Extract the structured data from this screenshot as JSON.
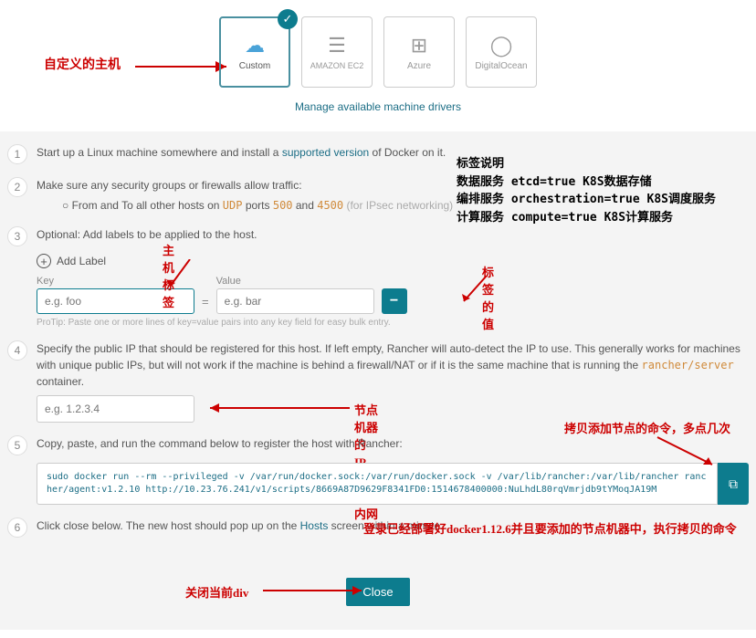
{
  "providers": {
    "custom": "Custom",
    "ec2": "AMAZON EC2",
    "azure": "Azure",
    "do": "DigitalOcean"
  },
  "custom_annot": "自定义的主机",
  "manage_link": "Manage available machine drivers",
  "tag_desc": {
    "l1": "标签说明",
    "l2": "数据服务  etcd=true  K8S数据存储",
    "l3": "编排服务  orchestration=true  K8S调度服务",
    "l4": "计算服务  compute=true  K8S计算服务"
  },
  "step1": {
    "pre": "Start up a Linux machine somewhere and install a ",
    "link": "supported version",
    "post": " of Docker on it."
  },
  "step2": {
    "line": "Make sure any security groups or firewalls allow traffic:",
    "bullet_pre": "From and To all other hosts on ",
    "udp": "UDP",
    "ports_txt": " ports ",
    "p1": "500",
    "and": " and ",
    "p2": "4500",
    "note": "  (for IPsec networking)"
  },
  "step3": {
    "line": "Optional: Add labels to be applied to the host.",
    "add_label": "Add Label",
    "key_label": "Key",
    "value_label": "Value",
    "key_ph": "e.g. foo",
    "val_ph": "e.g. bar",
    "protip": "ProTip: Paste one or more lines of key=value pairs into any key field for easy bulk entry.",
    "annot_key": "主机标签",
    "annot_val": "标签的值"
  },
  "step4": {
    "pre": "Specify the public IP that should be registered for this host. If left empty, Rancher will auto-detect the IP to use. This generally works for machines with unique public IPs, but will not work if the machine is behind a firewall/NAT or if it is the same machine that is running the ",
    "orange": "rancher/server",
    "post": " container.",
    "ip_ph": "e.g. 1.2.3.4",
    "annot_ip": "节点机器的IP，一般都是内网"
  },
  "step5": {
    "line": "Copy, paste, and run the command below to register the host with Rancher:",
    "cmd": "sudo docker run --rm --privileged -v /var/run/docker.sock:/var/run/docker.sock -v /var/lib/rancher:/var/lib/rancher rancher/agent:v1.2.10 http://10.23.76.241/v1/scripts/8669A87D9629F8341FD0:1514678400000:NuLhdL80rqVmrjdb9tYMoqJA19M",
    "annot_copy": "拷贝添加节点的命令，多点几次"
  },
  "step6": {
    "pre": "Click close below. The new host should pop up on the ",
    "link": "Hosts",
    "post": " screen within a minute.",
    "annot_login": "登录已经部署好docker1.12.6并且要添加的节点机器中，执行拷贝的命令"
  },
  "close": {
    "label": "Close",
    "annot": "关闭当前div"
  }
}
